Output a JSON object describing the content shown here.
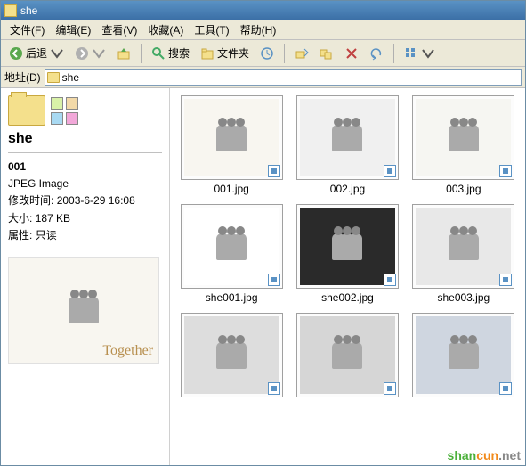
{
  "window": {
    "title": "she"
  },
  "menu": {
    "file": "文件(F)",
    "edit": "编辑(E)",
    "view": "查看(V)",
    "favorites": "收藏(A)",
    "tools": "工具(T)",
    "help": "帮助(H)"
  },
  "toolbar": {
    "back": "后退",
    "search": "搜索",
    "folders": "文件夹"
  },
  "addressbar": {
    "label": "地址(D)",
    "path": "she"
  },
  "sidepanel": {
    "folder_name": "she",
    "selected_file": "001",
    "file_type": "JPEG Image",
    "modified_label": "修改时间:",
    "modified_value": "2003-6-29 16:08",
    "size_label": "大小:",
    "size_value": "187 KB",
    "attrib_label": "属性:",
    "attrib_value": "只读",
    "preview_overlay": "Together"
  },
  "files": [
    {
      "name": "001.jpg"
    },
    {
      "name": "002.jpg"
    },
    {
      "name": "003.jpg"
    },
    {
      "name": "she001.jpg"
    },
    {
      "name": "she002.jpg"
    },
    {
      "name": "she003.jpg"
    },
    {
      "name": ""
    },
    {
      "name": ""
    },
    {
      "name": ""
    }
  ],
  "watermark": {
    "text1": "shan",
    "text2": "cun",
    "text3": ".net"
  }
}
